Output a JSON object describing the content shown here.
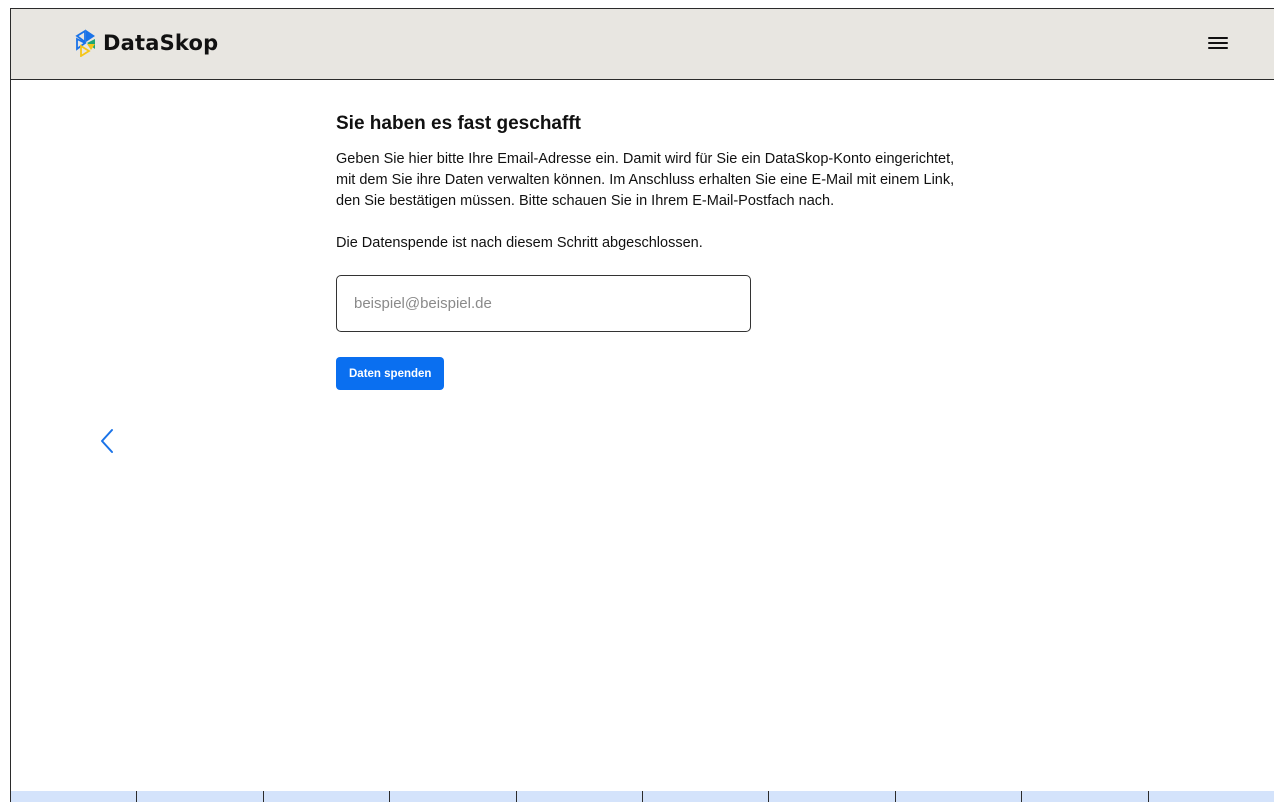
{
  "header": {
    "brand_name": "DataSkop",
    "logo_icon": "dataskop-logo-icon",
    "menu_icon": "hamburger-menu-icon"
  },
  "nav": {
    "back_icon": "chevron-left-icon"
  },
  "main": {
    "title": "Sie haben es fast geschafft",
    "paragraph_1": "Geben Sie hier bitte Ihre Email-Adresse ein. Damit wird für Sie ein DataSkop-Konto eingerichtet, mit dem Sie ihre Daten verwalten können. Im Anschluss erhalten Sie eine E-Mail mit einem Link, den Sie bestätigen müssen. Bitte schauen Sie in Ihrem E-Mail-Postfach nach.",
    "paragraph_2": "Die Datenspende ist nach diesem Schritt abgeschlossen.",
    "email_input": {
      "value": "",
      "placeholder": "beispiel@beispiel.de"
    },
    "submit_label": "Daten spenden"
  },
  "progress": {
    "segment_count": 10
  },
  "colors": {
    "header_bg": "#e8e6e1",
    "accent": "#0a6ff0",
    "progress_bg": "#d4e3fb",
    "logo_blue": "#1a73e8",
    "logo_yellow": "#f5c518",
    "logo_green": "#1fa672"
  }
}
